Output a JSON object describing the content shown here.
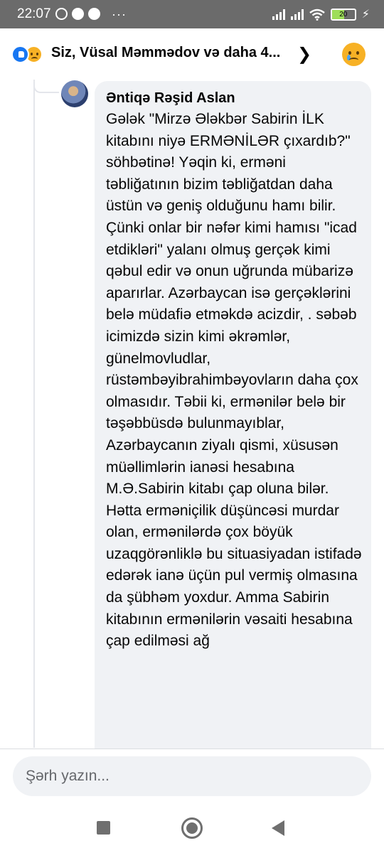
{
  "status_bar": {
    "time": "22:07",
    "left_icons": [
      "whatsapp-icon",
      "messenger-icon",
      "messenger-icon"
    ],
    "more_notifications": "···",
    "battery_level": "20",
    "charging": true
  },
  "reactions_header": {
    "text": "Siz, Vüsal Məmmədov və daha 4...",
    "reaction_types": [
      "like",
      "sad"
    ],
    "quick_reaction": "sad"
  },
  "comment": {
    "author": "Əntiqə Rəşid Aslan",
    "text": "Gələk  \"Mirzə Ələkbər Sabirin İLK kitabını niyə ERMƏNİLƏR çıxardıb?\" söhbətinə!  Yəqin ki, erməni təbliğatının bizim təbliğatdan daha üstün və geniş olduğunu hamı bilir. Çünki onlar bir nəfər kimi hamısı \"icad etdikləri\" yalanı olmuş gerçək kimi qəbul edir və onun uğrunda mübarizə aparırlar.  Azərbaycan isə gerçəklərini belə müdafiə etməkdə acizdir, . səbəb icimizdə sizin kimi əkrəmlər, günelmovludlar, rüstəmbəyibrahimbəyovların daha çox olmasıdır.  Təbii ki, ermənilər belə bir təşəbbüsdə bulunmayıblar, Azərbaycanın ziyalı qismi, xüsusən müəllimlərin ianəsi hesabına M.Ə.Sabirin kitabı çap oluna bilər. Hətta erməniçilik düşüncəsi murdar olan, ermənilərdə çox böyük uzaqgörənliklə bu situasiyadan istifadə edərək ianə üçün pul vermiş olmasına da şübhəm yoxdur. Amma Sabirin kitabının ermənilərin vəsaiti hesabına çap edilməsi ağ"
  },
  "composer": {
    "placeholder": "Şərh yazın..."
  },
  "nav_bar": {
    "buttons": [
      "recents-button",
      "home-button",
      "back-button"
    ]
  }
}
